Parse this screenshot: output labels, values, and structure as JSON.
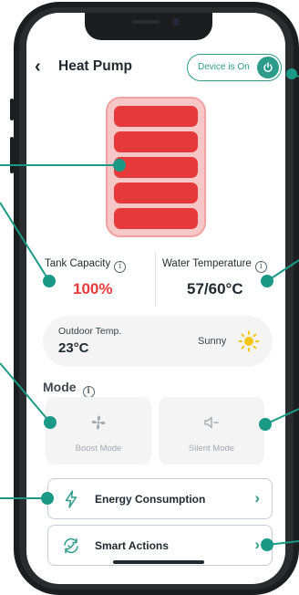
{
  "header": {
    "title": "Heat Pump",
    "back_icon": "chevron-left-icon",
    "device_status": "Device is On",
    "power_icon": "power-icon"
  },
  "tank": {
    "fill_level_bars": 5,
    "fill_color": "#e63a3a",
    "background_color": "#f7c6c6"
  },
  "stats": {
    "tank_capacity_label": "Tank Capacity",
    "tank_capacity_value": "100%",
    "tank_capacity_color": "#e63a3a",
    "water_temperature_label": "Water Temperature",
    "water_temperature_value": "57/60°C"
  },
  "outdoor": {
    "label": "Outdoor Temp.",
    "value": "23°C",
    "weather": "Sunny",
    "weather_icon": "sun-icon"
  },
  "mode": {
    "title": "Mode",
    "options": [
      {
        "label": "Boost Mode",
        "icon": "fan-icon"
      },
      {
        "label": "Silent Mode",
        "icon": "speaker-muted-icon"
      }
    ]
  },
  "actions": [
    {
      "label": "Energy Consumption",
      "icon": "lightning-icon"
    },
    {
      "label": "Smart Actions",
      "icon": "refresh-check-icon"
    }
  ],
  "accent_color": "#2d9b8a",
  "callout_color": "#1a9a86"
}
